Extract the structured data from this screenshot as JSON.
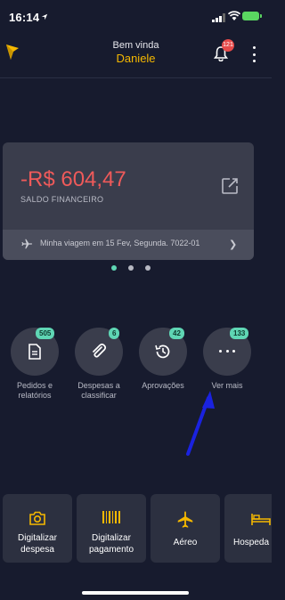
{
  "status_bar": {
    "time": "16:14"
  },
  "header": {
    "welcome": "Bem vinda",
    "user_name": "Daniele",
    "notification_count": "121"
  },
  "balance_card": {
    "amount": "-R$ 604,47",
    "label": "SALDO FINANCEIRO",
    "trip": "Minha viagem em 15 Fev, Segunda. 7022-01"
  },
  "shortcuts": [
    {
      "label_1": "Pedidos e",
      "label_2": "relatórios",
      "badge": "505",
      "icon": "document-icon"
    },
    {
      "label_1": "Despesas a",
      "label_2": "classificar",
      "badge": "6",
      "icon": "paperclip-icon"
    },
    {
      "label_1": "Aprovações",
      "label_2": "",
      "badge": "42",
      "icon": "history-icon"
    },
    {
      "label_1": "Ver mais",
      "label_2": "",
      "badge": "133",
      "icon": "more-icon"
    }
  ],
  "actions": [
    {
      "label_1": "Digitalizar",
      "label_2": "despesa",
      "icon": "camera-icon"
    },
    {
      "label_1": "Digitalizar",
      "label_2": "pagamento",
      "icon": "barcode-icon"
    },
    {
      "label_1": "Aéreo",
      "icon": "airplane-icon"
    },
    {
      "label_1": "Hospeda",
      "icon": "bed-icon"
    }
  ],
  "colors": {
    "background": "#171b2e",
    "accent": "#f5b800",
    "negative": "#ef5a5a",
    "badge": "#5fd6b4"
  }
}
